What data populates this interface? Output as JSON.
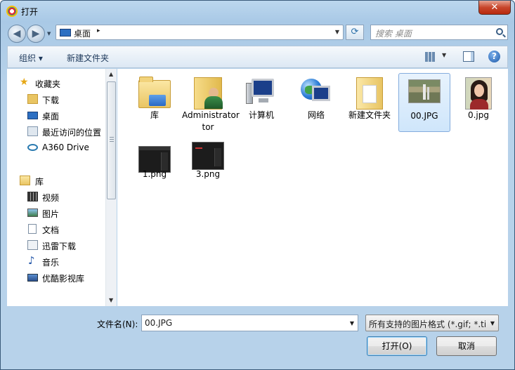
{
  "window": {
    "title": "打开",
    "close": "✕"
  },
  "address": {
    "path": "桌面",
    "separator": "▸"
  },
  "search": {
    "placeholder": "搜索 桌面"
  },
  "toolbar": {
    "organize": "组织 ▾",
    "new_folder": "新建文件夹",
    "help": "?"
  },
  "sidebar": {
    "items": [
      {
        "label": "收藏夹",
        "icon": "star-icon"
      },
      {
        "label": "下载",
        "icon": "download-folder-icon"
      },
      {
        "label": "桌面",
        "icon": "desktop-icon"
      },
      {
        "label": "最近访问的位置",
        "icon": "recent-places-icon"
      },
      {
        "label": "A360 Drive",
        "icon": "a360-drive-icon"
      },
      {
        "label": "库",
        "icon": "library-icon"
      },
      {
        "label": "视频",
        "icon": "video-icon"
      },
      {
        "label": "图片",
        "icon": "pictures-icon"
      },
      {
        "label": "文档",
        "icon": "documents-icon"
      },
      {
        "label": "迅雷下载",
        "icon": "thunder-download-icon"
      },
      {
        "label": "音乐",
        "icon": "music-icon"
      },
      {
        "label": "优酷影视库",
        "icon": "youku-library-icon"
      }
    ]
  },
  "files": [
    {
      "name": "库",
      "icon": "library-folder-icon"
    },
    {
      "name": "Administrator",
      "name2": "tor",
      "icon": "user-folder-icon"
    },
    {
      "name": "计算机",
      "icon": "computer-icon"
    },
    {
      "name": "网络",
      "icon": "network-icon"
    },
    {
      "name": "新建文件夹",
      "icon": "folder-icon"
    },
    {
      "name": "00.JPG",
      "icon": "image-thumbnail-crane",
      "selected": true
    },
    {
      "name": "0.jpg",
      "icon": "image-thumbnail-portrait"
    },
    {
      "name": "1.png",
      "icon": "image-thumbnail-dark"
    },
    {
      "name": "3.png",
      "icon": "image-thumbnail-dark"
    }
  ],
  "bottom": {
    "filename_label": "文件名(N):",
    "filename_value": "00.JPG",
    "filter_value": "所有支持的图片格式 (*.gif; *.tif",
    "open_button": "打开(O)",
    "cancel_button": "取消"
  },
  "colors": {
    "selection": "#cfe6fb",
    "frame": "#a9c9e6",
    "close": "#c8462c"
  }
}
